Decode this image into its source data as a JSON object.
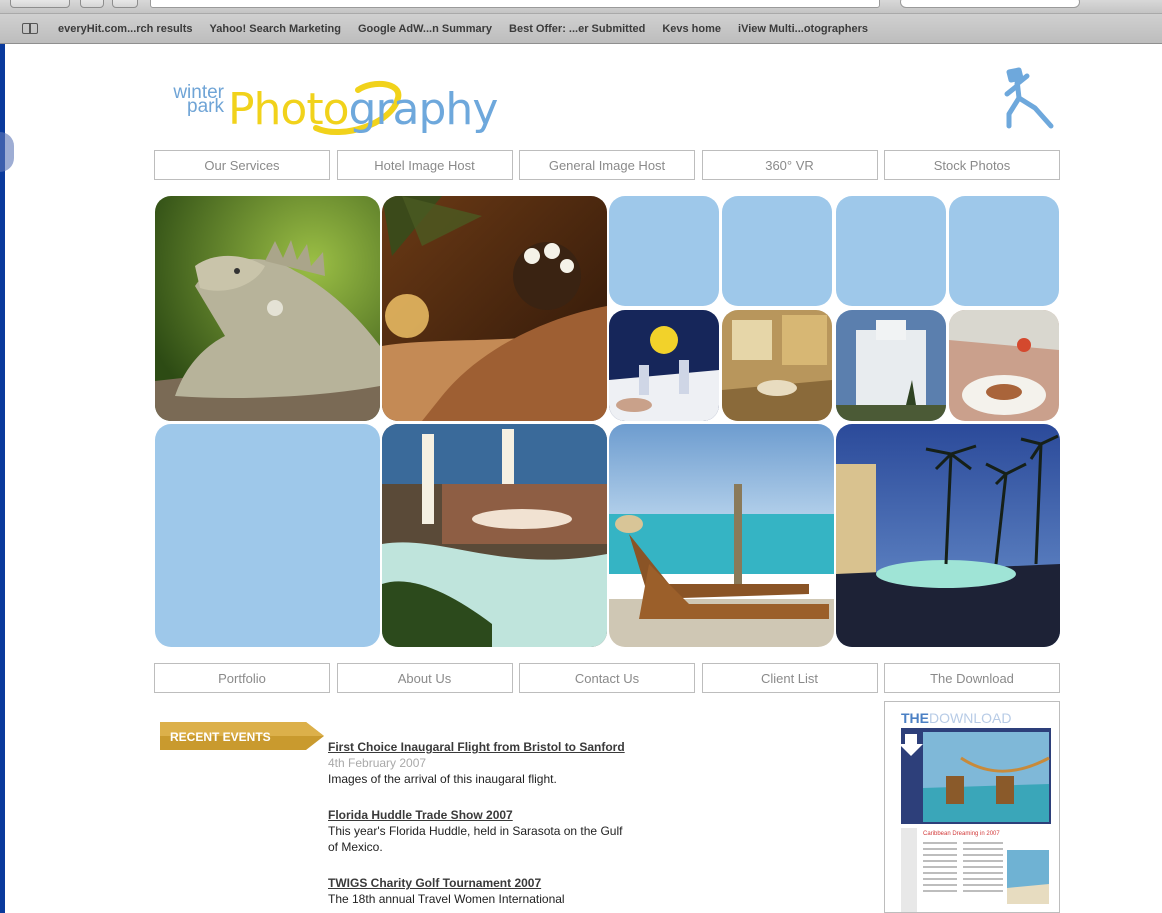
{
  "browser": {
    "bookmarks": [
      "everyHit.com...rch results",
      "Yahoo! Search Marketing",
      "Google AdW...n Summary",
      "Best Offer: ...er Submitted",
      "Kevs home",
      "iView Multi...otographers"
    ]
  },
  "logo": {
    "line1": "winter",
    "line2": "park",
    "photo": "Photo",
    "graphy": "graphy"
  },
  "nav_top": [
    "Our Services",
    "Hotel Image Host",
    "General Image Host",
    "360° VR",
    "Stock Photos"
  ],
  "nav_bottom": [
    "Portfolio",
    "About Us",
    "Contact Us",
    "Client List",
    "The Download"
  ],
  "recent_events": {
    "badge": "RECENT EVENTS",
    "items": [
      {
        "title": "First Choice Inaugaral Flight from Bristol to Sanford",
        "date": "4th February 2007",
        "desc": "Images of the arrival of this inaugaral flight."
      },
      {
        "title": "Florida Huddle Trade Show 2007",
        "date": "",
        "desc": "This year's Florida Huddle, held in Sarasota on the Gulf of Mexico."
      },
      {
        "title": "TWIGS Charity Golf Tournament 2007",
        "date": "",
        "desc": "The 18th annual Travel Women International"
      }
    ]
  },
  "download_panel": {
    "the": "THE",
    "download": "DOWNLOAD",
    "article_title": "Caribbean Dreaming in 2007"
  },
  "colors": {
    "tile_blue": "#9ec8ea",
    "logo_yellow": "#f1d21b",
    "logo_blue": "#6ea8dc",
    "badge_gold": "#c99a2e"
  }
}
